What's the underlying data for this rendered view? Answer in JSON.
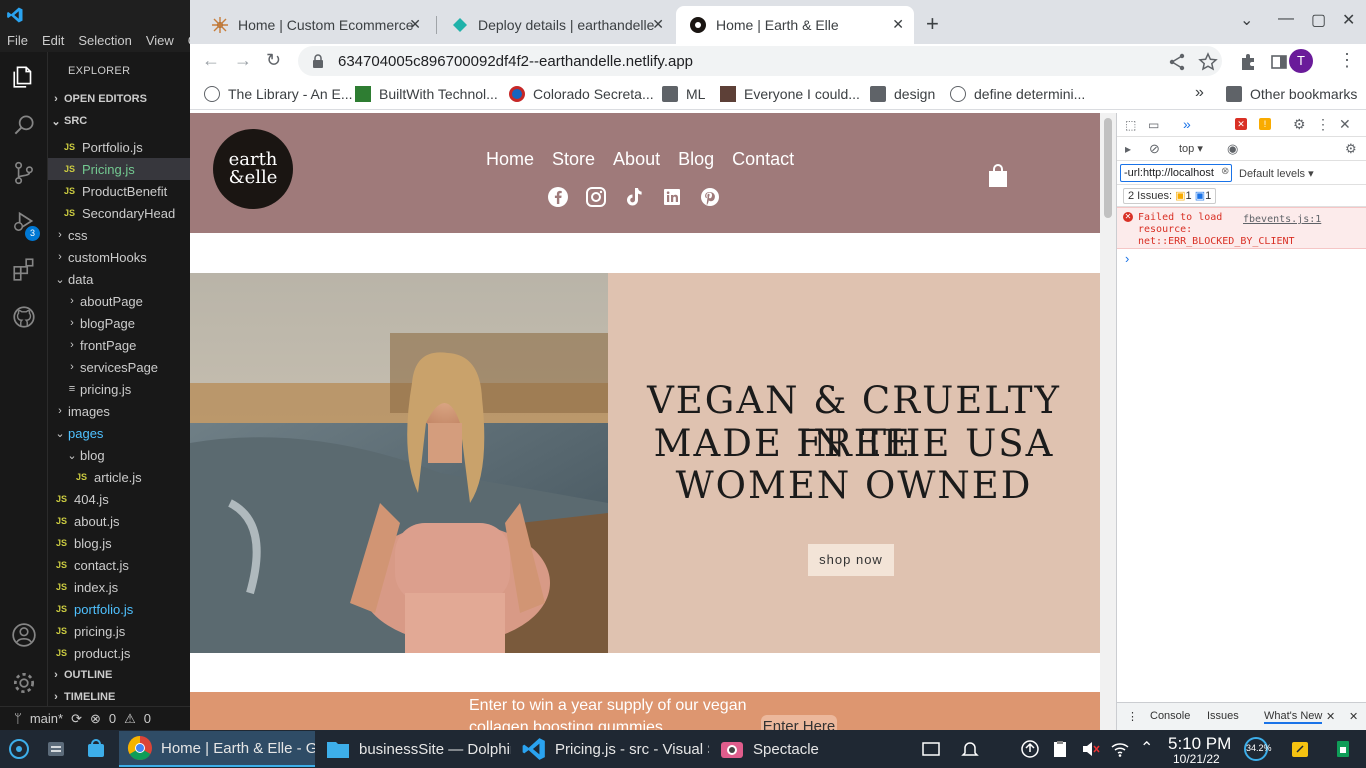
{
  "vscode": {
    "menu": [
      "File",
      "Edit",
      "Selection",
      "View",
      "G"
    ],
    "explorer_title": "EXPLORER",
    "scm_badge": "3",
    "tree": [
      {
        "label": "OPEN EDITORS",
        "kind": "section",
        "chev": "›"
      },
      {
        "label": "SRC",
        "kind": "section",
        "chev": "⌄"
      },
      {
        "label": "Portfolio.js",
        "kind": "js"
      },
      {
        "label": "Pricing.js",
        "kind": "js",
        "selected": true,
        "color": "green"
      },
      {
        "label": "ProductBenefit",
        "kind": "js"
      },
      {
        "label": "SecondaryHead",
        "kind": "js"
      },
      {
        "label": "css",
        "kind": "folder",
        "chev": "›"
      },
      {
        "label": "customHooks",
        "kind": "folder",
        "chev": "›"
      },
      {
        "label": "data",
        "kind": "folder",
        "chev": "⌄"
      },
      {
        "label": "aboutPage",
        "kind": "folder",
        "chev": "›"
      },
      {
        "label": "blogPage",
        "kind": "folder",
        "chev": "›"
      },
      {
        "label": "frontPage",
        "kind": "folder",
        "chev": "›"
      },
      {
        "label": "servicesPage",
        "kind": "folder",
        "chev": "›"
      },
      {
        "label": "pricing.js",
        "kind": "file"
      },
      {
        "label": "images",
        "kind": "folder",
        "chev": "›"
      },
      {
        "label": "pages",
        "kind": "folder",
        "chev": "⌄",
        "color": "blue"
      },
      {
        "label": "blog",
        "kind": "folder",
        "chev": "⌄"
      },
      {
        "label": "article.js",
        "kind": "js"
      },
      {
        "label": "404.js",
        "kind": "js"
      },
      {
        "label": "about.js",
        "kind": "js"
      },
      {
        "label": "blog.js",
        "kind": "js"
      },
      {
        "label": "contact.js",
        "kind": "js"
      },
      {
        "label": "index.js",
        "kind": "js"
      },
      {
        "label": "portfolio.js",
        "kind": "js",
        "color": "blue"
      },
      {
        "label": "pricing.js",
        "kind": "js"
      },
      {
        "label": "product.js",
        "kind": "js"
      },
      {
        "label": "OUTLINE",
        "kind": "section",
        "chev": "›"
      },
      {
        "label": "TIMELINE",
        "kind": "section",
        "chev": "›"
      }
    ],
    "js_badge": "JS",
    "status": {
      "branch": "main*",
      "errors": "0",
      "warnings": "0"
    }
  },
  "chrome": {
    "tabs": [
      {
        "title": "Home | Custom Ecommerce",
        "close": "✕"
      },
      {
        "title": "Deploy details | earthandelle",
        "close": "✕"
      },
      {
        "title": "Home | Earth & Elle",
        "close": "✕",
        "active": true
      }
    ],
    "new_tab": "+",
    "url": "634704005c896700092df4f2--earthandelle.netlify.app",
    "profile_initial": "T",
    "bookmarks": [
      "The Library - An E...",
      "BuiltWith Technol...",
      "Colorado Secreta...",
      "ML",
      "Everyone I could...",
      "design",
      "define determini..."
    ],
    "bookmarks_more": "»",
    "other_bookmarks": "Other bookmarks"
  },
  "site": {
    "logo_line1": "earth",
    "logo_line2": "&elle",
    "nav": [
      "Home",
      "Store",
      "About",
      "Blog",
      "Contact"
    ],
    "hero_lines": [
      "VEGAN & CRUELTY FREE",
      "MADE IN THE USA",
      "WOMEN OWNED"
    ],
    "shop_now": "shop now",
    "promo_text": "Enter to win a year supply of our vegan collagen boosting gummies",
    "enter_here": "Enter Here"
  },
  "devtools": {
    "context": "top",
    "filter_value": "-url:http://localhost",
    "levels": "Default levels",
    "issues_label": "2 Issues:",
    "issues_warn": "1",
    "issues_info": "1",
    "error_text": "Failed to load resource: net::ERR_BLOCKED_BY_CLIENT",
    "error_source": "fbevents.js:1",
    "prompt": "›",
    "bottom_tabs": [
      "Console",
      "Issues",
      "What's New"
    ]
  },
  "taskbar": {
    "tasks": [
      "Home | Earth & Elle - G...",
      "businessSite — Dolphin",
      "Pricing.js - src - Visual S...",
      "Spectacle"
    ],
    "battery": "34.2%",
    "time": "5:10 PM",
    "date": "10/21/22"
  },
  "colors": {
    "site_header": "#9f7a7a",
    "hero_panel": "#dfc2b0",
    "promo_bar": "#dd9670",
    "vscode_bg": "#181818"
  }
}
